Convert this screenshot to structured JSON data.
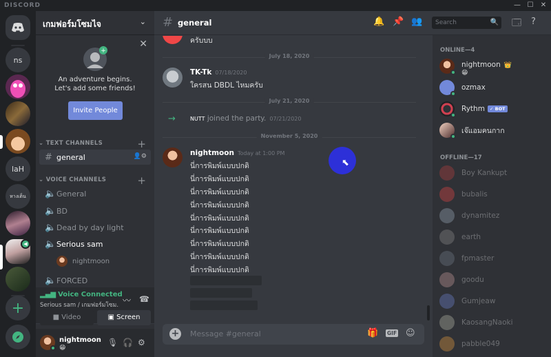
{
  "window": {
    "brand": "DISCORD",
    "minimize": "—",
    "maximize": "☐",
    "close": "✕"
  },
  "guilds": [
    {
      "label": "",
      "icon": "discord-logo"
    },
    {
      "label": "ns"
    },
    {
      "label": ""
    },
    {
      "label": ""
    },
    {
      "label": ""
    },
    {
      "label": "laH"
    },
    {
      "label": "หางเต็น"
    },
    {
      "label": ""
    },
    {
      "label": ""
    },
    {
      "label": ""
    },
    {
      "label": "+",
      "icon": "add-server"
    },
    {
      "label": "",
      "icon": "explore-compass"
    }
  ],
  "server": {
    "name": "เกมฟอร์มโซมไจ",
    "chevron": "⌄"
  },
  "invite": {
    "text": "An adventure begins.\nLet's add some friends!",
    "button": "Invite People"
  },
  "categories": {
    "text": "TEXT CHANNELS",
    "voice": "VOICE CHANNELS"
  },
  "text_channels": [
    {
      "name": "general",
      "icon": "#"
    }
  ],
  "voice_channels": [
    {
      "name": "General"
    },
    {
      "name": "BD"
    },
    {
      "name": "Dead by day light"
    },
    {
      "name": "Serious sam"
    },
    {
      "name": "FORCED"
    }
  ],
  "voice_users": [
    {
      "name": "nightmoon"
    }
  ],
  "voice_connection": {
    "status": "Voice Connected",
    "subtitle": "Serious sam / เกมฟอร์มโซม...",
    "video": "Video",
    "screen": "Screen"
  },
  "user": {
    "name": "nightmoon",
    "status_emoji": "😁"
  },
  "channel": {
    "name": "general",
    "hash": "#"
  },
  "search": {
    "placeholder": "Search"
  },
  "messages": {
    "top_line": "ครับบบ",
    "divider1": "July 18, 2020",
    "tk": {
      "author": "TK-Tk",
      "time": "07/18/2020",
      "text": "ใครสน DBDL ไหมครับ"
    },
    "divider2": "July 21, 2020",
    "system": {
      "user": "NUTT",
      "text": "joined the party.",
      "time": "07/21/2020"
    },
    "divider3": "November 5, 2020",
    "nm": {
      "author": "nightmoon",
      "time": "Today at 1:00 PM",
      "lines": [
        "นี่การพิมพ์แบบปกติ",
        "นี่การพิมพ์แบบปกติ",
        "นี่การพิมพ์แบบปกติ",
        "นี่การพิมพ์แบบปกติ",
        "นี่การพิมพ์แบบปกติ",
        "นี่การพิมพ์แบบปกติ",
        "นี่การพิมพ์แบบปกติ",
        "นี่การพิมพ์แบบปกติ",
        "นี่การพิมพ์แบบปกติ"
      ]
    }
  },
  "composer": {
    "placeholder": "Message #general",
    "gif": "GIF"
  },
  "members": {
    "online_header": "ONLINE—4",
    "online": [
      {
        "name": "nightmoon",
        "emoji": "😁",
        "crown": "👑"
      },
      {
        "name": "ozmax"
      },
      {
        "name": "Rythm",
        "badge": "✓ BOT"
      },
      {
        "name": "เจ๊แอมคนกาก"
      }
    ],
    "offline_header": "OFFLINE—17",
    "offline": [
      {
        "name": "Boy Kankupt"
      },
      {
        "name": "bubalis"
      },
      {
        "name": "dynamitez"
      },
      {
        "name": "earth"
      },
      {
        "name": "fpmaster"
      },
      {
        "name": "goodu"
      },
      {
        "name": "Gumjeaw"
      },
      {
        "name": "KaosangNaoki"
      },
      {
        "name": "pabble049"
      }
    ]
  },
  "colors": {
    "accent": "#7289da",
    "online": "#43b581",
    "bg_chat": "#36393f",
    "bg_side": "#2f3136",
    "bg_guild": "#202225"
  }
}
